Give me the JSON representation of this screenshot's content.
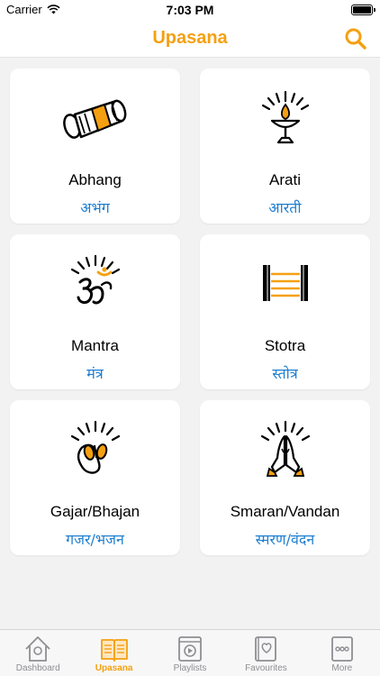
{
  "status": {
    "carrier": "Carrier",
    "time": "7:03 PM"
  },
  "nav": {
    "title": "Upasana",
    "search_icon": "search-icon"
  },
  "colors": {
    "accent": "#f5a011",
    "subtitle": "#1f7fd1",
    "tab_inactive": "#8e8e93"
  },
  "cards": [
    {
      "title": "Abhang",
      "subtitle": "अभंग",
      "icon": "dholak-drum-icon"
    },
    {
      "title": "Arati",
      "subtitle": "आरती",
      "icon": "arati-lamp-icon"
    },
    {
      "title": "Mantra",
      "subtitle": "मंत्र",
      "icon": "om-icon"
    },
    {
      "title": "Stotra",
      "subtitle": "स्तोत्र",
      "icon": "scroll-icon"
    },
    {
      "title": "Gajar/Bhajan",
      "subtitle": "गजर/भजन",
      "icon": "cymbals-icon"
    },
    {
      "title": "Smaran/Vandan",
      "subtitle": "स्मरण/वंदन",
      "icon": "folded-hands-icon"
    }
  ],
  "tabs": [
    {
      "label": "Dashboard",
      "icon": "home-icon",
      "active": false
    },
    {
      "label": "Upasana",
      "icon": "book-icon",
      "active": true
    },
    {
      "label": "Playlists",
      "icon": "playlist-icon",
      "active": false
    },
    {
      "label": "Favourites",
      "icon": "favourites-icon",
      "active": false
    },
    {
      "label": "More",
      "icon": "more-icon",
      "active": false
    }
  ]
}
